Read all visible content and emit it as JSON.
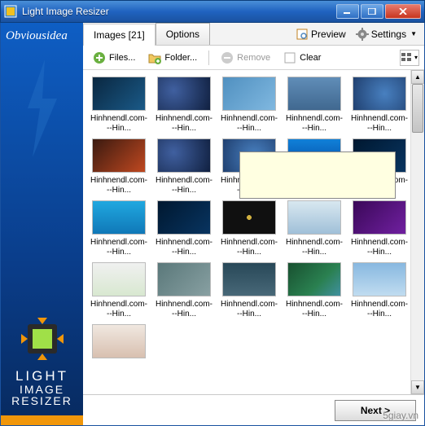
{
  "window": {
    "title": "Light Image Resizer"
  },
  "sidebar": {
    "brand": "Obviousidea",
    "product_line1": "LIGHT",
    "product_line2": "IMAGE",
    "product_line3": "RESIZER"
  },
  "tabs": {
    "images_label": "Images [21]",
    "options_label": "Options"
  },
  "commands": {
    "preview_label": "Preview",
    "settings_label": "Settings"
  },
  "toolbar": {
    "files_label": "Files...",
    "folder_label": "Folder...",
    "remove_label": "Remove",
    "clear_label": "Clear"
  },
  "filename": "Hinhnendl.com---Hin...",
  "footer": {
    "next_label": "Next >"
  },
  "watermark": "5giay.vn"
}
